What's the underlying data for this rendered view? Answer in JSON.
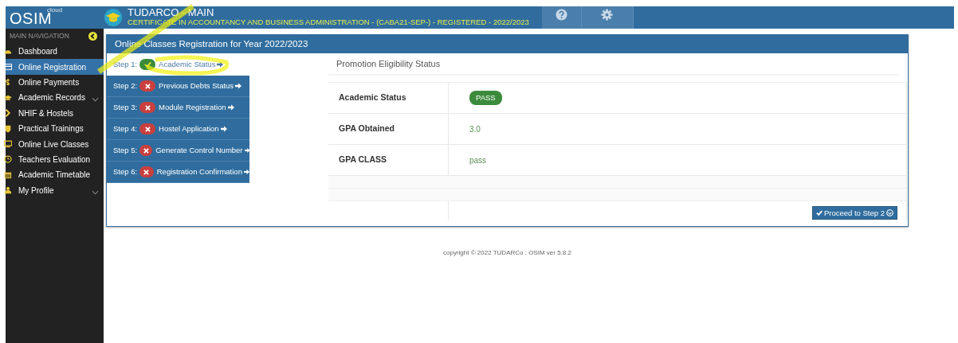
{
  "header": {
    "logo": "OSIM",
    "logo_tag": "cloud",
    "title": "TUDARCO - MAIN",
    "subtitle": "CERTIFICATE IN ACCOUNTANCY AND BUSINESS ADMINISTRATION - (CABA21-SEP-) - REGISTERED - 2022/2023"
  },
  "sidebar": {
    "heading": "MAIN NAVIGATION",
    "items": [
      {
        "label": "Dashboard",
        "selected": false,
        "has_submenu": false
      },
      {
        "label": "Online Registration",
        "selected": true,
        "has_submenu": false
      },
      {
        "label": "Online Payments",
        "selected": false,
        "has_submenu": false
      },
      {
        "label": "Academic Records",
        "selected": false,
        "has_submenu": true
      },
      {
        "label": "NHIF & Hostels",
        "selected": false,
        "has_submenu": false
      },
      {
        "label": "Practical Trainings",
        "selected": false,
        "has_submenu": false
      },
      {
        "label": "Online Live Classes",
        "selected": false,
        "has_submenu": false
      },
      {
        "label": "Teachers Evaluation",
        "selected": false,
        "has_submenu": false
      },
      {
        "label": "Academic Timetable",
        "selected": false,
        "has_submenu": false
      },
      {
        "label": "My Profile",
        "selected": false,
        "has_submenu": true
      }
    ]
  },
  "panel": {
    "title": "Online Classes Registration for Year 2022/2023",
    "steps": [
      {
        "step": "Step 1:",
        "label": "Academic Status",
        "done": true,
        "selected": true
      },
      {
        "step": "Step 2:",
        "label": "Previous Debts Status",
        "done": false,
        "selected": false
      },
      {
        "step": "Step 3:",
        "label": "Module Registration",
        "done": false,
        "selected": false
      },
      {
        "step": "Step 4:",
        "label": "Hostel Application",
        "done": false,
        "selected": false
      },
      {
        "step": "Step 5:",
        "label": "Generate Control Number",
        "done": false,
        "selected": false
      },
      {
        "step": "Step 6:",
        "label": "Registration Confirmation",
        "done": false,
        "selected": false
      }
    ],
    "section_title": "Promotion Eligibility Status",
    "rows": [
      {
        "label": "Academic Status",
        "value": "PASS",
        "kind": "badge"
      },
      {
        "label": "GPA Obtained",
        "value": "3.0",
        "kind": "text"
      },
      {
        "label": "GPA CLASS",
        "value": "pass",
        "kind": "text"
      }
    ],
    "button": "Proceed to Step 2"
  },
  "footer": "copyright © 2022 TUDARCo : OSIM ver 5.8.2"
}
